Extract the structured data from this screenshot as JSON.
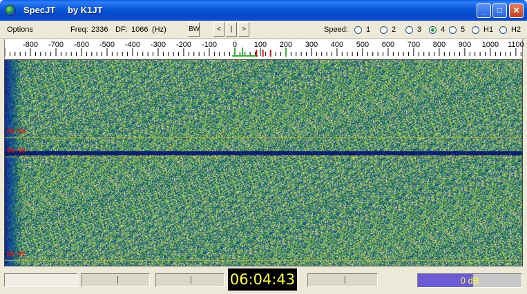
{
  "window": {
    "title": "SpecJT",
    "author": "by K1JT",
    "minimize_glyph": "_",
    "maximize_glyph": "□",
    "close_glyph": "✕",
    "icon": "globe-icon"
  },
  "toolbar": {
    "options_label": "Options",
    "freq_label": "Freq:",
    "freq_value": "2336",
    "df_label": "DF:",
    "df_value": "1066",
    "df_unit": "(Hz)",
    "bw_label": "BW",
    "nav_left": "<",
    "nav_center": "|",
    "nav_right": ">",
    "speed_label": "Speed:",
    "speed_options": [
      "1",
      "2",
      "3",
      "4",
      "5",
      "H1",
      "H2"
    ],
    "speed_selected": "4"
  },
  "scale": {
    "labels": [
      "-800",
      "-700",
      "-600",
      "-500",
      "-400",
      "-300",
      "-200",
      "-100",
      "0",
      "100",
      "200",
      "300",
      "400",
      "500",
      "600",
      "700",
      "800",
      "900",
      "1000",
      "1100"
    ],
    "min_hz": -900,
    "max_hz": 1130,
    "green_markers_hz": [
      0,
      30,
      200
    ],
    "red_markers_hz": [
      85,
      110,
      140
    ]
  },
  "waterfall": {
    "time_marks": [
      "06:04",
      "06:03",
      "06:02"
    ],
    "colors": {
      "base": "#0b1e6b",
      "low": "#1a4aa8",
      "mid": "#1f8a6a",
      "high": "#8fbf3a",
      "peak": "#e8e0a0"
    }
  },
  "status": {
    "clock": "06:04:43",
    "level": "0 dB",
    "level_fill": 0.53
  }
}
